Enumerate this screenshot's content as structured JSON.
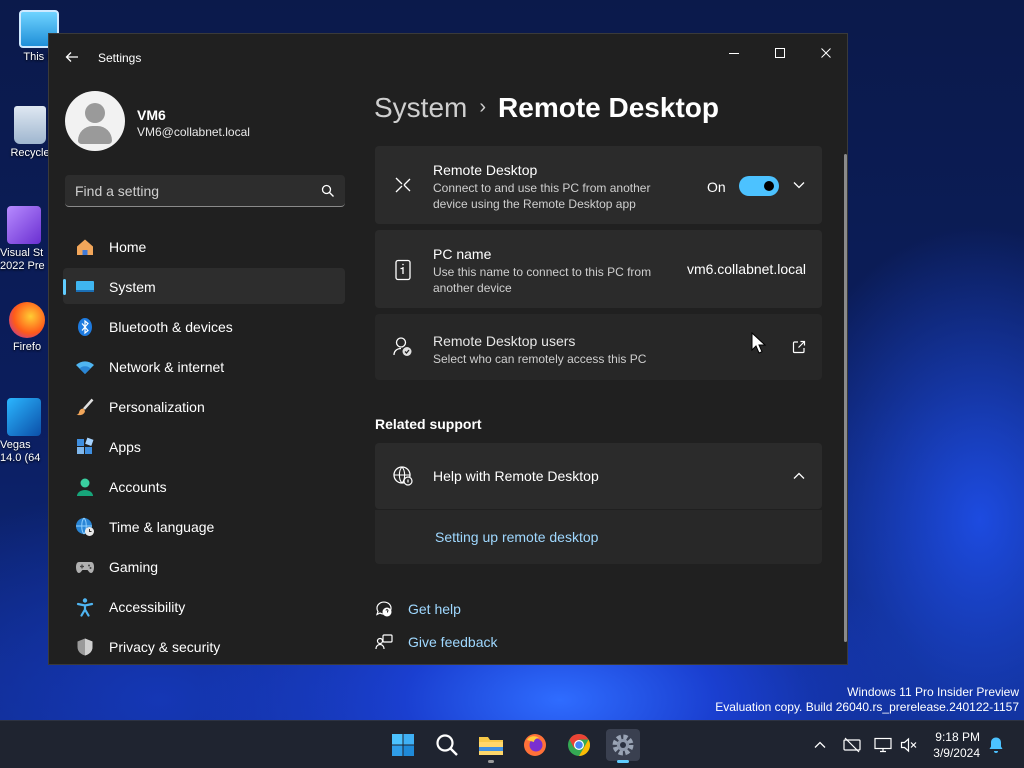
{
  "desktop": {
    "icons": [
      {
        "label": "This P",
        "icon": "monitor-icon"
      },
      {
        "label": "Recycle",
        "icon": "recycle-bin-icon"
      },
      {
        "label": "Visual St 2022 Pre",
        "icon": "visual-studio-icon"
      },
      {
        "label": "Firefo",
        "icon": "firefox-icon"
      },
      {
        "label": "Vegas 14.0 (64",
        "icon": "vegas-icon"
      }
    ],
    "watermark": {
      "line1": "Windows 11 Pro Insider Preview",
      "line2": "Evaluation copy. Build 26040.rs_prerelease.240122-1157"
    }
  },
  "window": {
    "title": "Settings",
    "controls": {
      "minimize": "minimize-icon",
      "maximize": "maximize-icon",
      "close": "close-icon"
    }
  },
  "profile": {
    "name": "VM6",
    "email": "VM6@collabnet.local"
  },
  "search": {
    "placeholder": "Find a setting",
    "value": ""
  },
  "nav": {
    "items": [
      {
        "label": "Home",
        "icon": "home-icon",
        "selected": false
      },
      {
        "label": "System",
        "icon": "system-icon",
        "selected": true
      },
      {
        "label": "Bluetooth & devices",
        "icon": "bluetooth-icon",
        "selected": false
      },
      {
        "label": "Network & internet",
        "icon": "wifi-icon",
        "selected": false
      },
      {
        "label": "Personalization",
        "icon": "brush-icon",
        "selected": false
      },
      {
        "label": "Apps",
        "icon": "apps-icon",
        "selected": false
      },
      {
        "label": "Accounts",
        "icon": "accounts-icon",
        "selected": false
      },
      {
        "label": "Time & language",
        "icon": "globe-clock-icon",
        "selected": false
      },
      {
        "label": "Gaming",
        "icon": "gamepad-icon",
        "selected": false
      },
      {
        "label": "Accessibility",
        "icon": "accessibility-icon",
        "selected": false
      },
      {
        "label": "Privacy & security",
        "icon": "shield-icon",
        "selected": false
      }
    ]
  },
  "breadcrumb": {
    "parent": "System",
    "separator": "›",
    "current": "Remote Desktop"
  },
  "cards": {
    "remote_desktop": {
      "title": "Remote Desktop",
      "description": "Connect to and use this PC from another device using the Remote Desktop app",
      "toggle_state": "On",
      "toggle_on": true
    },
    "pc_name": {
      "title": "PC name",
      "description": "Use this name to connect to this PC from another device",
      "value": "vm6.collabnet.local"
    },
    "users": {
      "title": "Remote Desktop users",
      "description": "Select who can remotely access this PC"
    }
  },
  "related": {
    "title": "Related support",
    "help": {
      "title": "Help with Remote Desktop",
      "link": "Setting up remote desktop",
      "expanded": true
    }
  },
  "footer": {
    "get_help": "Get help",
    "give_feedback": "Give feedback"
  },
  "taskbar": {
    "apps": [
      "start-icon",
      "search-icon",
      "file-explorer-icon",
      "firefox-icon",
      "chrome-icon",
      "settings-icon"
    ],
    "active_app": "settings-icon",
    "clock": {
      "time": "9:18 PM",
      "date": "3/9/2024"
    }
  },
  "colors": {
    "accent": "#4cc2ff",
    "link": "#9fd8ff",
    "window_bg": "#202020",
    "card_bg": "#2b2b2b"
  }
}
